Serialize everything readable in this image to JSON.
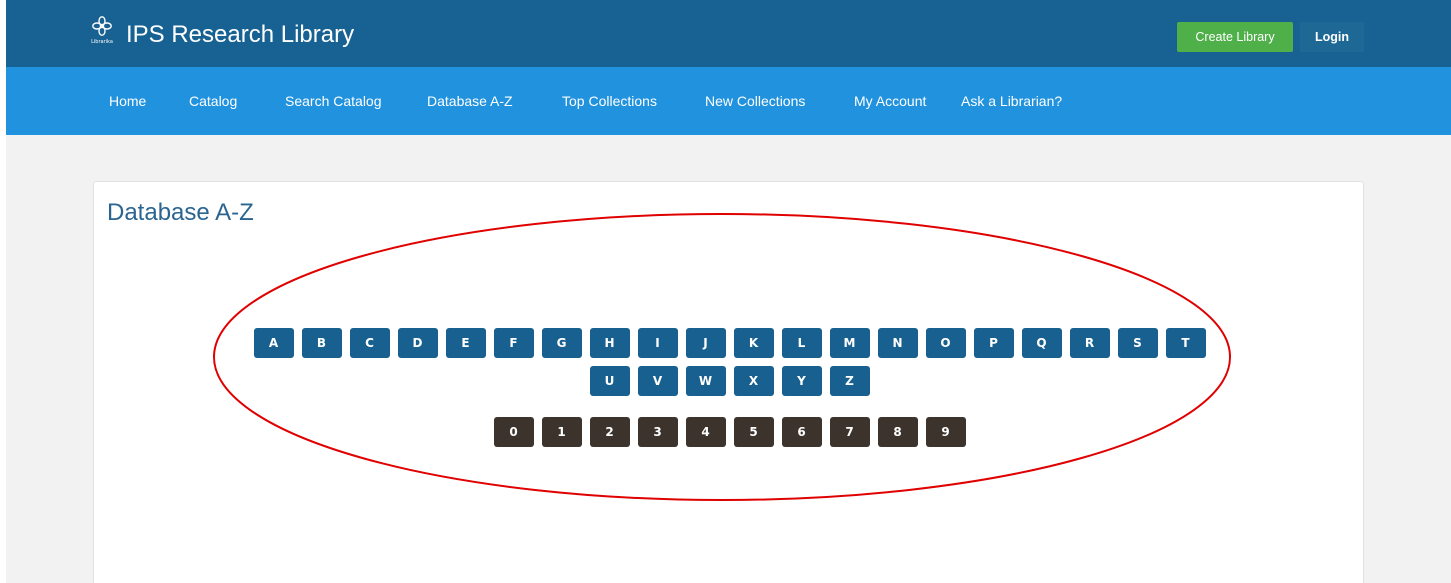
{
  "header": {
    "logo_icon": "flower-logo-icon",
    "logo_text": "Librarika",
    "title": "IPS Research Library",
    "create_label": "Create Library",
    "login_label": "Login",
    "colors": {
      "header_bg": "#176293",
      "create_bg": "#4fb04a"
    }
  },
  "nav": {
    "items": [
      {
        "label": "Home"
      },
      {
        "label": "Catalog"
      },
      {
        "label": "Search Catalog"
      },
      {
        "label": "Database A-Z"
      },
      {
        "label": "Top Collections"
      },
      {
        "label": "New Collections"
      },
      {
        "label": "My Account"
      },
      {
        "label": "Ask a Librarian?"
      }
    ],
    "bg_color": "#2092de"
  },
  "main": {
    "title": "Database A-Z",
    "letters_row1": [
      "A",
      "B",
      "C",
      "D",
      "E",
      "F",
      "G",
      "H",
      "I",
      "J",
      "K",
      "L",
      "M",
      "N",
      "O",
      "P",
      "Q",
      "R",
      "S",
      "T"
    ],
    "letters_row2": [
      "U",
      "V",
      "W",
      "X",
      "Y",
      "Z"
    ],
    "digits": [
      "0",
      "1",
      "2",
      "3",
      "4",
      "5",
      "6",
      "7",
      "8",
      "9"
    ],
    "colors": {
      "letter_bg": "#186090",
      "digit_bg": "#3b332c",
      "annotation": "#e00000"
    }
  }
}
